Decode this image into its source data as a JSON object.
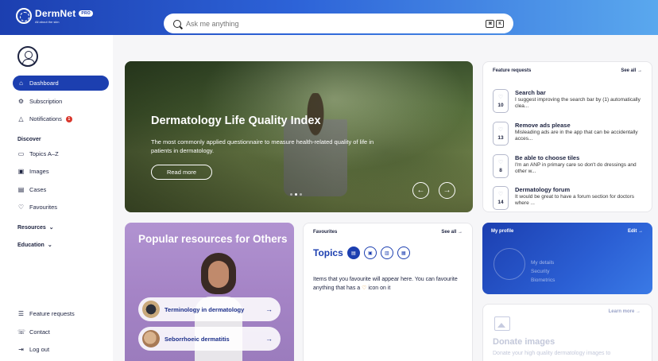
{
  "brand": {
    "name": "DermNet",
    "badge": "PRO",
    "tagline": "All about the skin"
  },
  "search": {
    "placeholder": "Ask me anything",
    "shortcut_keys": [
      "⌘",
      "K"
    ]
  },
  "sidebar": {
    "items": [
      {
        "label": "Dashboard",
        "icon": "home-icon"
      },
      {
        "label": "Subscription",
        "icon": "gear-icon"
      },
      {
        "label": "Notifications",
        "icon": "bell-icon",
        "badge": "1"
      }
    ],
    "discover_heading": "Discover",
    "discover_items": [
      {
        "label": "Topics A–Z",
        "icon": "book-icon"
      },
      {
        "label": "Images",
        "icon": "image-icon"
      },
      {
        "label": "Cases",
        "icon": "case-icon"
      },
      {
        "label": "Favourites",
        "icon": "heart-icon"
      }
    ],
    "resources_label": "Resources",
    "education_label": "Education",
    "bottom_items": [
      {
        "label": "Feature requests",
        "icon": "list-icon"
      },
      {
        "label": "Contact",
        "icon": "phone-icon"
      },
      {
        "label": "Log out",
        "icon": "logout-icon"
      }
    ]
  },
  "hero": {
    "title": "Dermatology Life Quality Index",
    "subtitle": "The most commonly applied questionnaire to measure health-related quality of life in patients in dermatology.",
    "button": "Read more",
    "slides_count": 3,
    "active_slide": 2
  },
  "feature_requests": {
    "heading": "Feature requests",
    "see_all": "See all",
    "items": [
      {
        "votes": "10",
        "title": "Search bar",
        "desc": "I suggest improving the search bar by (1) automatically clea..."
      },
      {
        "votes": "13",
        "title": "Remove ads please",
        "desc": "Misleading ads are in the app that can be accidentally acces..."
      },
      {
        "votes": "8",
        "title": "Be able to choose tiles",
        "desc": "I'm an ANP in primary care so don't do dressings and other w..."
      },
      {
        "votes": "14",
        "title": "Dermatology forum",
        "desc": "It would be great to have a forum section for doctors where ..."
      }
    ]
  },
  "popular": {
    "title": "Popular resources for Others",
    "items": [
      {
        "label": "Terminology in dermatology"
      },
      {
        "label": "Seborrhoeic dermatitis"
      }
    ]
  },
  "favourites": {
    "heading": "Favourites",
    "see_all": "See all",
    "topics_label": "Topics",
    "text_before": "Items that you favourite will appear here. You can favourite anything that has a",
    "text_after": "icon on it"
  },
  "profile": {
    "heading": "My profile",
    "edit": "Edit",
    "links": [
      "My details",
      "Security",
      "Biometrics"
    ]
  },
  "donate": {
    "learn_more": "Learn more",
    "title": "Donate images",
    "desc": "Donate your high quality dermatology images to"
  },
  "colors": {
    "accent": "#1c3fb0",
    "badge": "#d9362b",
    "popular_bg": "#a584c6"
  }
}
